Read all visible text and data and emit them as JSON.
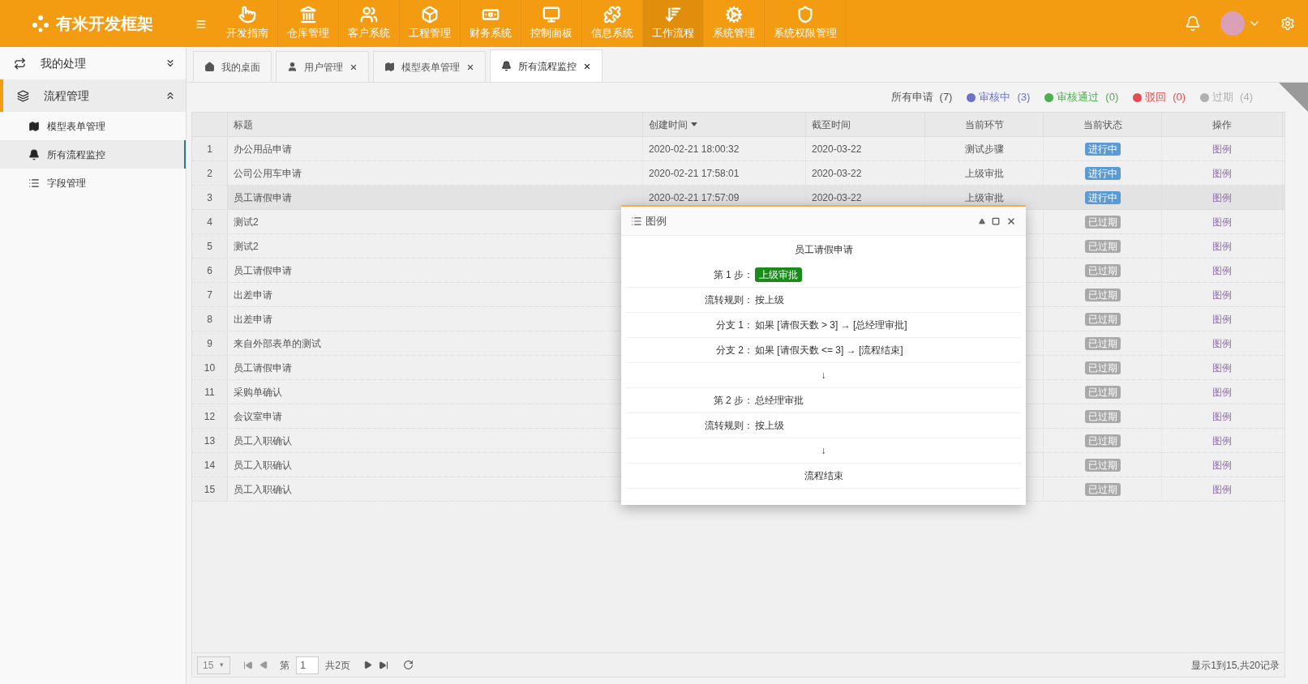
{
  "header": {
    "brand": "有米开发框架",
    "menu_icon": "≡",
    "nav": [
      {
        "label": "开发指南",
        "selected": false
      },
      {
        "label": "仓库管理",
        "selected": false
      },
      {
        "label": "客户系统",
        "selected": false
      },
      {
        "label": "工程管理",
        "selected": false
      },
      {
        "label": "财务系统",
        "selected": false
      },
      {
        "label": "控制面板",
        "selected": false
      },
      {
        "label": "信息系统",
        "selected": false
      },
      {
        "label": "工作流程",
        "selected": true
      },
      {
        "label": "系统管理",
        "selected": false
      },
      {
        "label": "系统权限管理",
        "selected": false
      }
    ]
  },
  "sidebar": {
    "groups": [
      {
        "label": "我的处理",
        "expanded": false
      },
      {
        "label": "流程管理",
        "expanded": true,
        "children": [
          {
            "label": "模型表单管理",
            "selected": false
          },
          {
            "label": "所有流程监控",
            "selected": true
          },
          {
            "label": "字段管理",
            "selected": false
          }
        ]
      }
    ]
  },
  "tabs": [
    {
      "label": "我的桌面",
      "selected": false,
      "closable": false
    },
    {
      "label": "用户管理",
      "selected": false,
      "closable": true
    },
    {
      "label": "模型表单管理",
      "selected": false,
      "closable": true
    },
    {
      "label": "所有流程监控",
      "selected": true,
      "closable": true
    }
  ],
  "filters": [
    {
      "label": "所有申请",
      "count": "(7)"
    },
    {
      "label": "审核中",
      "count": "(3)",
      "color": "#6a72c9"
    },
    {
      "label": "审核通过",
      "count": "(0)",
      "color": "#4cae4c"
    },
    {
      "label": "驳回",
      "count": "(0)",
      "color": "#e9494f"
    },
    {
      "label": "过期",
      "count": "(4)",
      "color": "#b0b0b0"
    }
  ],
  "table": {
    "columns": [
      {
        "label": "标题"
      },
      {
        "label": "创建时间",
        "sorted": true
      },
      {
        "label": "截至时间"
      },
      {
        "label": "当前环节"
      },
      {
        "label": "当前状态"
      },
      {
        "label": "操作"
      }
    ],
    "rows": [
      {
        "index": "1",
        "title": "办公用品申请",
        "created": "2020-02-21 18:00:32",
        "deadline": "2020-03-22",
        "node": "测试步骤",
        "status": {
          "kind": "running",
          "text": "进行中"
        },
        "action": "图例",
        "selected": false
      },
      {
        "index": "2",
        "title": "公司公用车申请",
        "created": "2020-02-21 17:58:01",
        "deadline": "2020-03-22",
        "node": "上级审批",
        "status": {
          "kind": "running",
          "text": "进行中"
        },
        "action": "图例",
        "selected": false
      },
      {
        "index": "3",
        "title": "员工请假申请",
        "created": "2020-02-21 17:57:09",
        "deadline": "2020-03-22",
        "node": "上级审批",
        "status": {
          "kind": "running",
          "text": "进行中"
        },
        "action": "图例",
        "selected": true
      },
      {
        "index": "4",
        "title": "测试2",
        "status": {
          "kind": "expired",
          "text": "已过期"
        },
        "action": "图例",
        "selected": false
      },
      {
        "index": "5",
        "title": "测试2",
        "status": {
          "kind": "expired",
          "text": "已过期"
        },
        "action": "图例",
        "selected": false
      },
      {
        "index": "6",
        "title": "员工请假申请",
        "status": {
          "kind": "expired",
          "text": "已过期"
        },
        "action": "图例",
        "selected": false
      },
      {
        "index": "7",
        "title": "出差申请",
        "status": {
          "kind": "expired",
          "text": "已过期"
        },
        "action": "图例",
        "selected": false
      },
      {
        "index": "8",
        "title": "出差申请",
        "status": {
          "kind": "expired",
          "text": "已过期"
        },
        "action": "图例",
        "selected": false
      },
      {
        "index": "9",
        "title": "来自外部表单的测试",
        "status": {
          "kind": "expired",
          "text": "已过期"
        },
        "action": "图例",
        "selected": false
      },
      {
        "index": "10",
        "title": "员工请假申请",
        "status": {
          "kind": "expired",
          "text": "已过期"
        },
        "action": "图例",
        "selected": false
      },
      {
        "index": "11",
        "title": "采购单确认",
        "status": {
          "kind": "expired",
          "text": "已过期"
        },
        "action": "图例",
        "selected": false
      },
      {
        "index": "12",
        "title": "会议室申请",
        "status": {
          "kind": "expired",
          "text": "已过期"
        },
        "action": "图例",
        "selected": false
      },
      {
        "index": "13",
        "title": "员工入职确认",
        "status": {
          "kind": "expired",
          "text": "已过期"
        },
        "action": "图例",
        "selected": false
      },
      {
        "index": "14",
        "title": "员工入职确认",
        "status": {
          "kind": "expired",
          "text": "已过期"
        },
        "action": "图例",
        "selected": false
      },
      {
        "index": "15",
        "title": "员工入职确认",
        "status": {
          "kind": "expired",
          "text": "已过期"
        },
        "action": "图例",
        "selected": false
      }
    ]
  },
  "pager": {
    "page_size": "15",
    "size_caret": "▼",
    "page_label": "第",
    "page": "1",
    "total_pages": "共2页",
    "summary": "显示1到15,共20记录"
  },
  "dialog": {
    "title": "图例",
    "heading": "员工请假申请",
    "lines": [
      {
        "kind": "step",
        "label": "第 1 步：",
        "value": "上级审批",
        "current": true
      },
      {
        "kind": "field",
        "label": "流转规则：",
        "value": "按上级"
      },
      {
        "kind": "field",
        "label": "分支 1：",
        "value": "如果 [请假天数 > 3] → [总经理审批]"
      },
      {
        "kind": "field",
        "label": "分支 2：",
        "value": "如果 [请假天数 <= 3] → [流程结束]"
      },
      {
        "kind": "arrow",
        "text": "↓"
      },
      {
        "kind": "step",
        "label": "第 2 步：",
        "value": "总经理审批",
        "current": false
      },
      {
        "kind": "field",
        "label": "流转规则：",
        "value": "按上级"
      },
      {
        "kind": "arrow",
        "text": "↓"
      },
      {
        "kind": "end",
        "text": "流程结束"
      }
    ]
  }
}
